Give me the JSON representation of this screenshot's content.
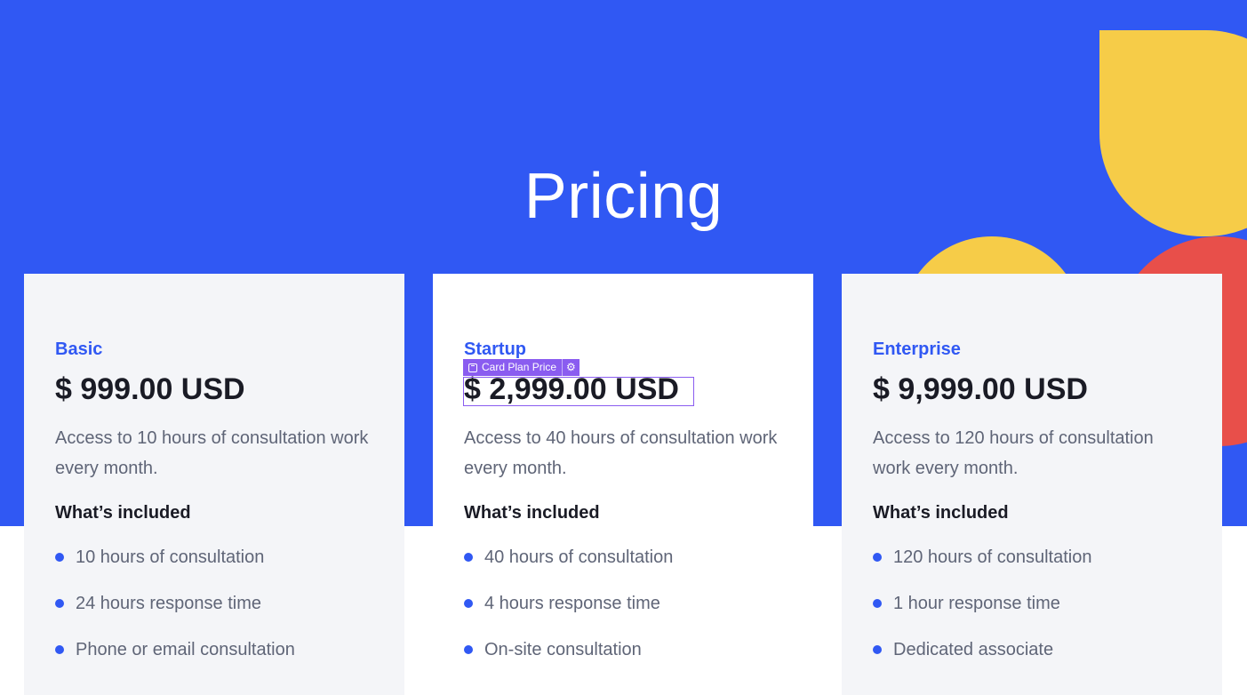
{
  "hero": {
    "title": "Pricing"
  },
  "editor": {
    "selected_tag": "Card Plan Price",
    "gear_icon": "gear-icon"
  },
  "plans": [
    {
      "name": "Basic",
      "price": "$ 999.00 USD",
      "description": "Access to 10 hours of consultation work every month.",
      "included_heading": "What’s included",
      "features": [
        "10 hours of consultation",
        "24 hours response time",
        "Phone or email consultation"
      ]
    },
    {
      "name": "Startup",
      "price": "$ 2,999.00 USD",
      "description": "Access to 40 hours of consultation work every month.",
      "included_heading": "What’s included",
      "features": [
        "40 hours of consultation",
        "4 hours response time",
        "On-site consultation"
      ]
    },
    {
      "name": "Enterprise",
      "price": "$ 9,999.00 USD",
      "description": "Access to 120 hours of consultation work every month.",
      "included_heading": "What’s included",
      "features": [
        "120 hours of consultation",
        "1 hour response time",
        "Dedicated associate"
      ]
    }
  ],
  "colors": {
    "hero_bg": "#3058f3",
    "accent_yellow": "#f6cc48",
    "accent_red": "#e84f4a",
    "plan_name": "#3058f3",
    "selection": "#8a5cf0"
  }
}
